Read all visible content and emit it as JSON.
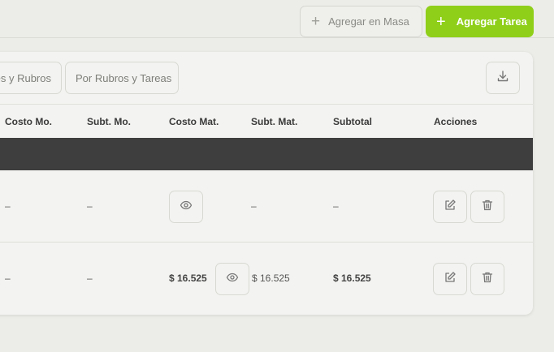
{
  "toolbar": {
    "bulk_add_label": "Agregar en Masa",
    "add_task_label": "Agregar Tarea",
    "plus_symbol": "+"
  },
  "filters": {
    "chip1_label": "es y Rubros",
    "chip2_label": "Por Rubros y Tareas"
  },
  "table": {
    "headers": [
      "Costo Mo.",
      "Subt. Mo.",
      "Costo Mat.",
      "Subt. Mat.",
      "Subtotal",
      "Acciones"
    ],
    "rows": [
      {
        "costo_mo": "–",
        "subt_mo": "–",
        "costo_mat": "",
        "subt_mat": "–",
        "subtotal": "–"
      },
      {
        "costo_mo": "–",
        "subt_mo": "–",
        "costo_mat": "$ 16.525",
        "subt_mat": "$ 16.525",
        "subtotal": "$ 16.525"
      }
    ]
  },
  "colors": {
    "accent": "#8fcf1a",
    "group_row": "#3e3e3e",
    "background": "#ecece8",
    "card": "#f3f3f1"
  },
  "icons": [
    "plus-icon",
    "download-icon",
    "eye-icon",
    "edit-icon",
    "trash-icon"
  ]
}
